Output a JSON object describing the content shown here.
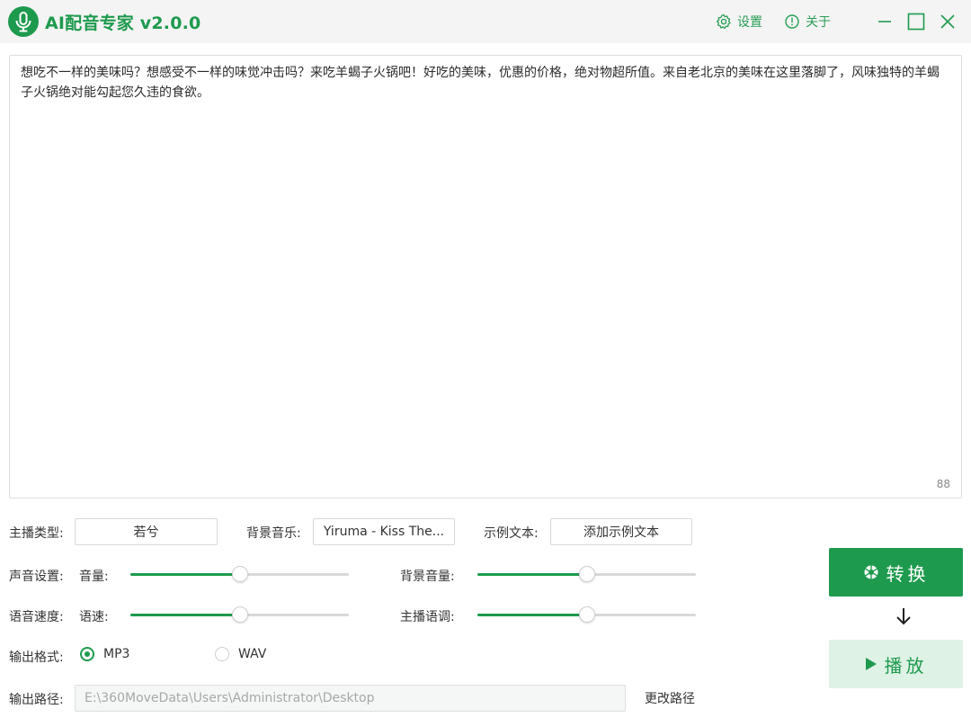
{
  "app": {
    "title": "AI配音专家 v2.0.0"
  },
  "titlebar": {
    "settings_label": "设置",
    "about_label": "关于"
  },
  "editor": {
    "text": "想吃不一样的美味吗？想感受不一样的味觉冲击吗？来吃羊蝎子火锅吧！好吃的美味，优惠的价格，绝对物超所值。来自老北京的美味在这里落脚了，风味独特的羊蝎子火锅绝对能勾起您久违的食欲。",
    "char_count": "88"
  },
  "form": {
    "anchor_type_label": "主播类型:",
    "anchor_type_value": "若兮",
    "bgm_label": "背景音乐:",
    "bgm_value": "Yiruma - Kiss The...",
    "sample_text_label": "示例文本:",
    "sample_text_button": "添加示例文本",
    "voice_settings_label": "声音设置:",
    "volume_label": "音量:",
    "volume_level": 0.5,
    "bgm_volume_label": "背景音量:",
    "bgm_volume_level": 0.5,
    "speed_section_label": "语音速度:",
    "speed_label": "语速:",
    "speed_level": 0.5,
    "tone_label": "主播语调:",
    "tone_level": 0.5,
    "output_format_label": "输出格式:",
    "format_options": [
      "MP3",
      "WAV"
    ],
    "format_selected": "MP3",
    "output_path_label": "输出路径:",
    "output_path_value": "E:\\360MoveData\\Users\\Administrator\\Desktop",
    "change_path_label": "更改路径"
  },
  "actions": {
    "convert_label": "转换",
    "play_label": "播放"
  },
  "colors": {
    "accent": "#1e9a4e",
    "play_bg": "#dff2e6",
    "titlebar_bg": "#f3f4f3"
  },
  "icons": {
    "logo": "microphone-logo-icon",
    "settings": "gear-icon",
    "about": "info-circle-icon",
    "minimize": "minimize-icon",
    "maximize": "maximize-icon",
    "close": "close-icon",
    "convert": "aperture-icon",
    "play": "play-icon",
    "arrow": "arrow-down-icon"
  }
}
